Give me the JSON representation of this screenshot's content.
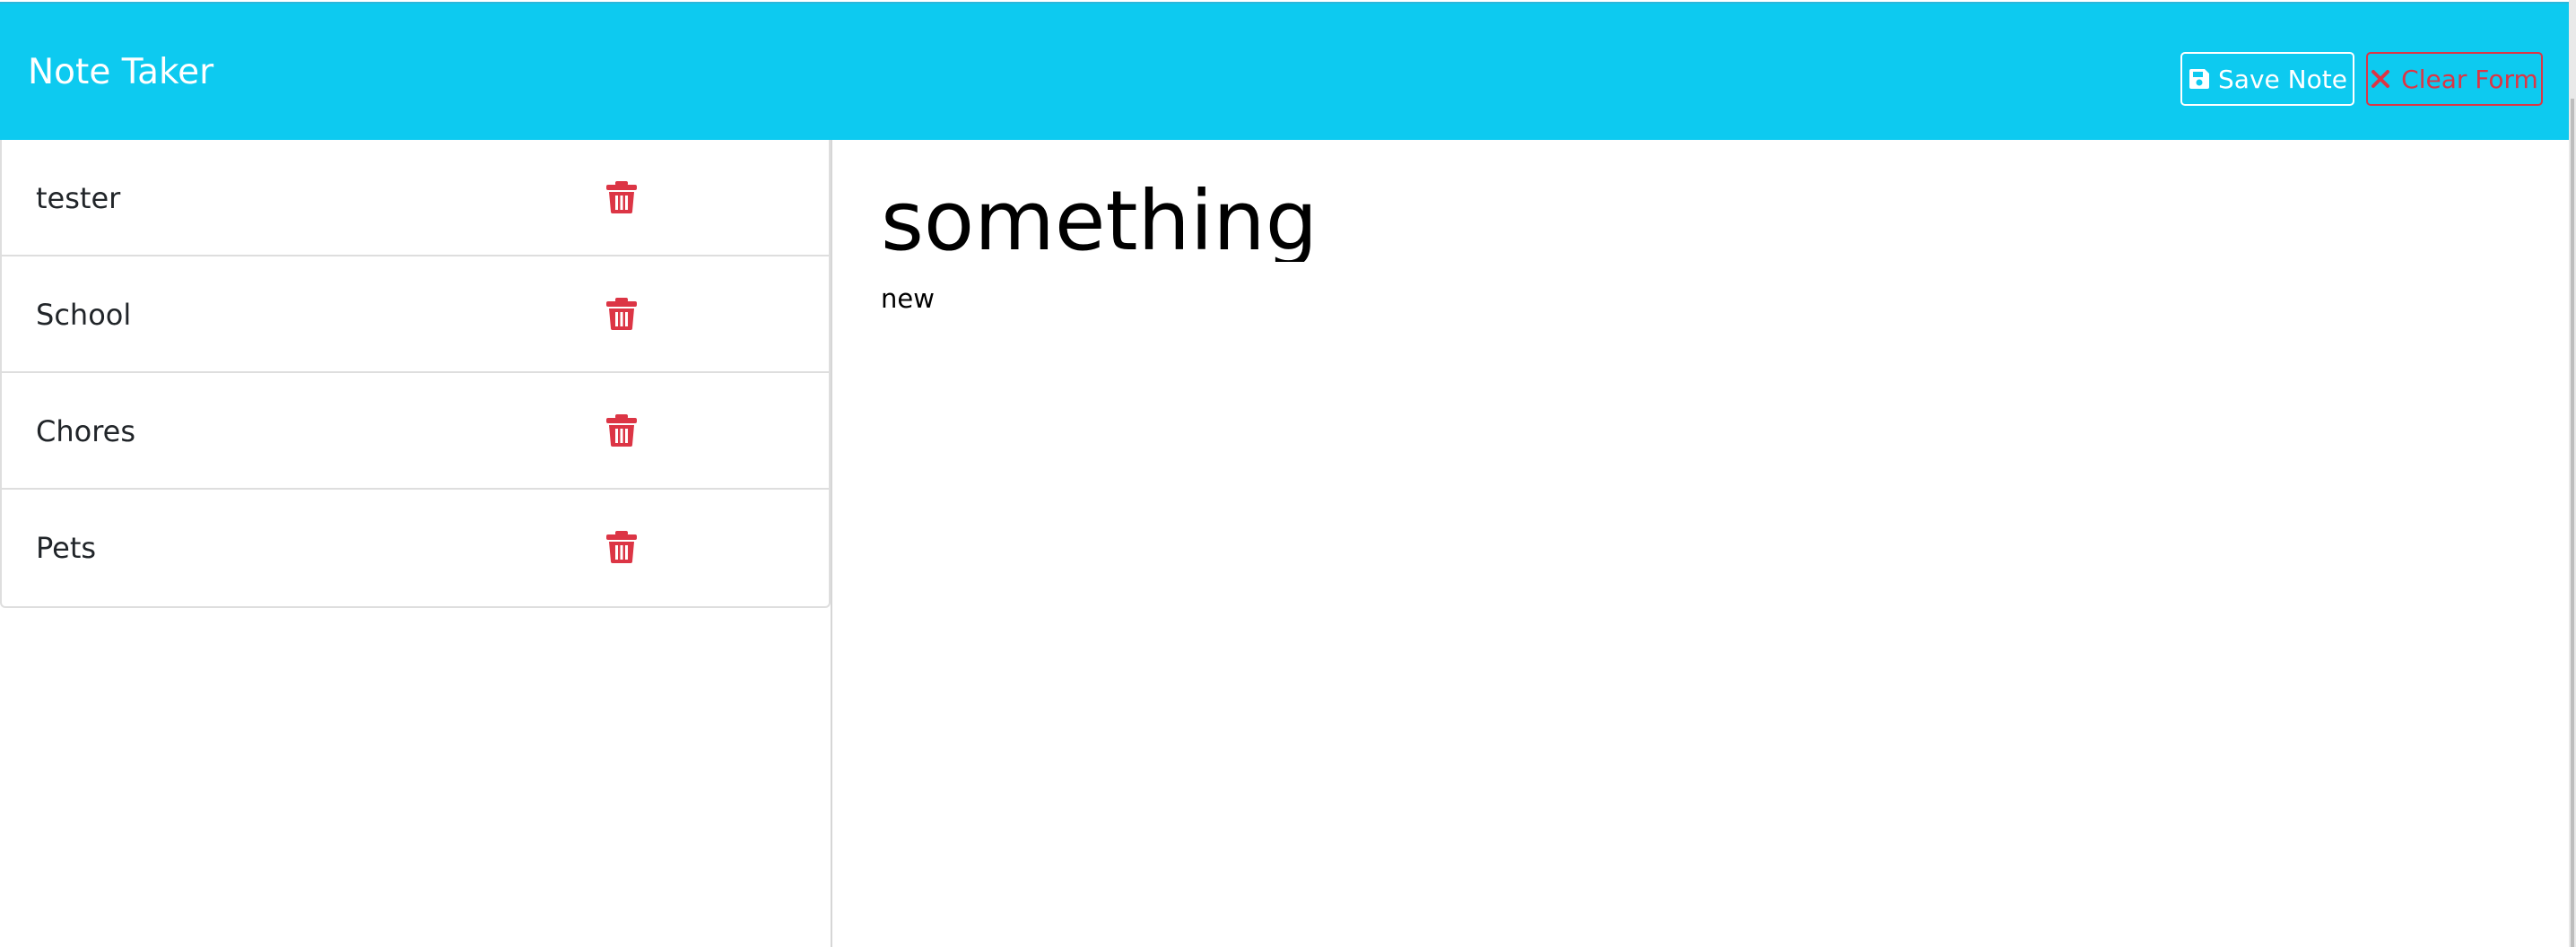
{
  "app": {
    "title": "Note Taker"
  },
  "toolbar": {
    "save_label": "Save Note",
    "clear_label": "Clear Form"
  },
  "notes": [
    {
      "title": "tester"
    },
    {
      "title": "School"
    },
    {
      "title": "Chores"
    },
    {
      "title": "Pets"
    }
  ],
  "active_note": {
    "title": "something",
    "text": "new"
  },
  "icons": {
    "save": "floppy-disk-icon",
    "clear": "x-icon",
    "delete": "trash-icon"
  },
  "colors": {
    "navbar": "#0dcaf0",
    "danger": "#dc3545",
    "white": "#ffffff"
  }
}
